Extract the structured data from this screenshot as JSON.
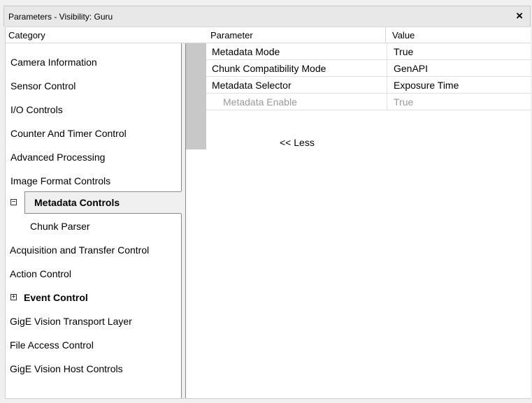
{
  "window": {
    "title": "Parameters - Visibility: Guru",
    "close_glyph": "×"
  },
  "columns": {
    "category": "Category",
    "parameter": "Parameter",
    "value": "Value"
  },
  "categories": [
    {
      "label": "Camera Information"
    },
    {
      "label": "Sensor Control"
    },
    {
      "label": "I/O Controls"
    },
    {
      "label": "Counter And Timer Control"
    },
    {
      "label": "Advanced Processing"
    },
    {
      "label": "Image Format Controls"
    },
    {
      "label": "Metadata Controls",
      "expander": "⊟",
      "bold": true,
      "selected": true
    },
    {
      "label": "Chunk Parser",
      "child": true
    },
    {
      "label": "Acquisition and Transfer Control"
    },
    {
      "label": "Action Control"
    },
    {
      "label": "Event Control",
      "expander": "⊞",
      "bold": true
    },
    {
      "label": "GigE Vision Transport Layer"
    },
    {
      "label": "File Access Control"
    },
    {
      "label": "GigE Vision Host Controls"
    }
  ],
  "parameters": [
    {
      "name": "Metadata Mode",
      "value": "True"
    },
    {
      "name": "Chunk Compatibility Mode",
      "value": "GenAPI"
    },
    {
      "name": "Metadata Selector",
      "value": "Exposure Time"
    },
    {
      "name": "Metadata Enable",
      "value": "True",
      "disabled": true
    }
  ],
  "less_label": "<< Less"
}
